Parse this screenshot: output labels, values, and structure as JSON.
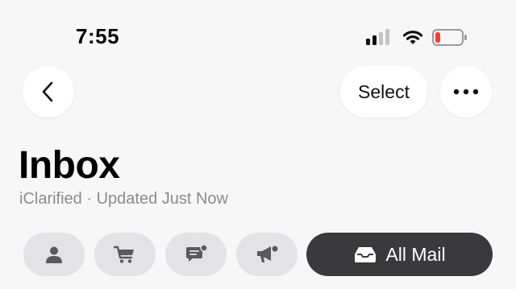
{
  "status_bar": {
    "time": "7:55",
    "signal_icon": "cellular-signal-icon",
    "wifi_icon": "wifi-icon",
    "battery_icon": "battery-low-icon",
    "battery_level": 0.15,
    "battery_color": "#ff3b30"
  },
  "nav": {
    "back_icon": "chevron-left-icon",
    "select_label": "Select",
    "more_icon": "ellipsis-icon"
  },
  "header": {
    "title": "Inbox",
    "subtitle": "iClarified · Updated Just Now"
  },
  "categories": {
    "items": [
      {
        "icon": "person-icon",
        "selected": false
      },
      {
        "icon": "cart-icon",
        "selected": false
      },
      {
        "icon": "message-badge-icon",
        "selected": false
      },
      {
        "icon": "megaphone-icon",
        "selected": false
      }
    ],
    "all_mail": {
      "icon": "tray-icon",
      "label": "All Mail",
      "selected": true
    }
  },
  "colors": {
    "background": "#f7f7f7",
    "chip": "#e3e3e6",
    "chip_selected": "#3a3a3c",
    "subtitle": "#8b8b8f"
  }
}
